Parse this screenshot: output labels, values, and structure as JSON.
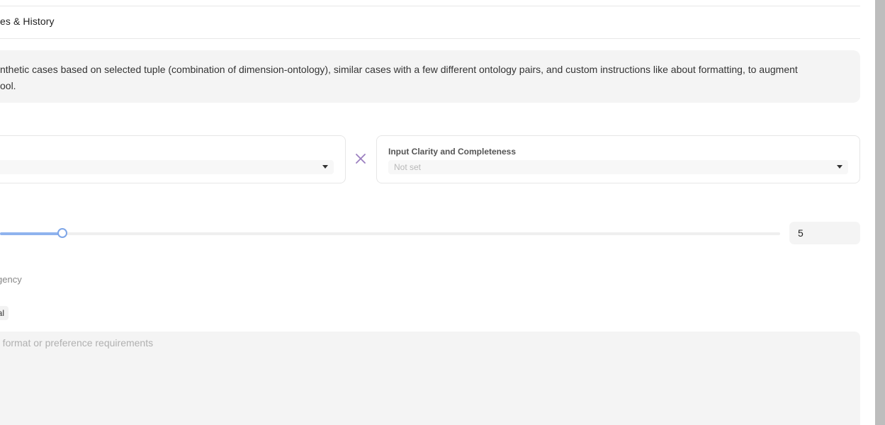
{
  "tabs": {
    "history_label": "es & History"
  },
  "info": {
    "line1": "nthetic cases based on selected tuple (combination of dimension-ontology), similar cases with a few different ontology pairs, and custom instructions like about formatting, to augment",
    "line2": "ool."
  },
  "left_select": {
    "value": ""
  },
  "right_select": {
    "title": "Input Clarity and Completeness",
    "value": "Not set"
  },
  "count": {
    "value": "5",
    "fraction": 0.08
  },
  "extra": {
    "sublabel": "gency",
    "chip": "al"
  },
  "instructions": {
    "placeholder": "e format or preference requirements"
  },
  "colors": {
    "accent_purple": "#9b7fc0",
    "slider_blue": "#8fb3ee"
  }
}
